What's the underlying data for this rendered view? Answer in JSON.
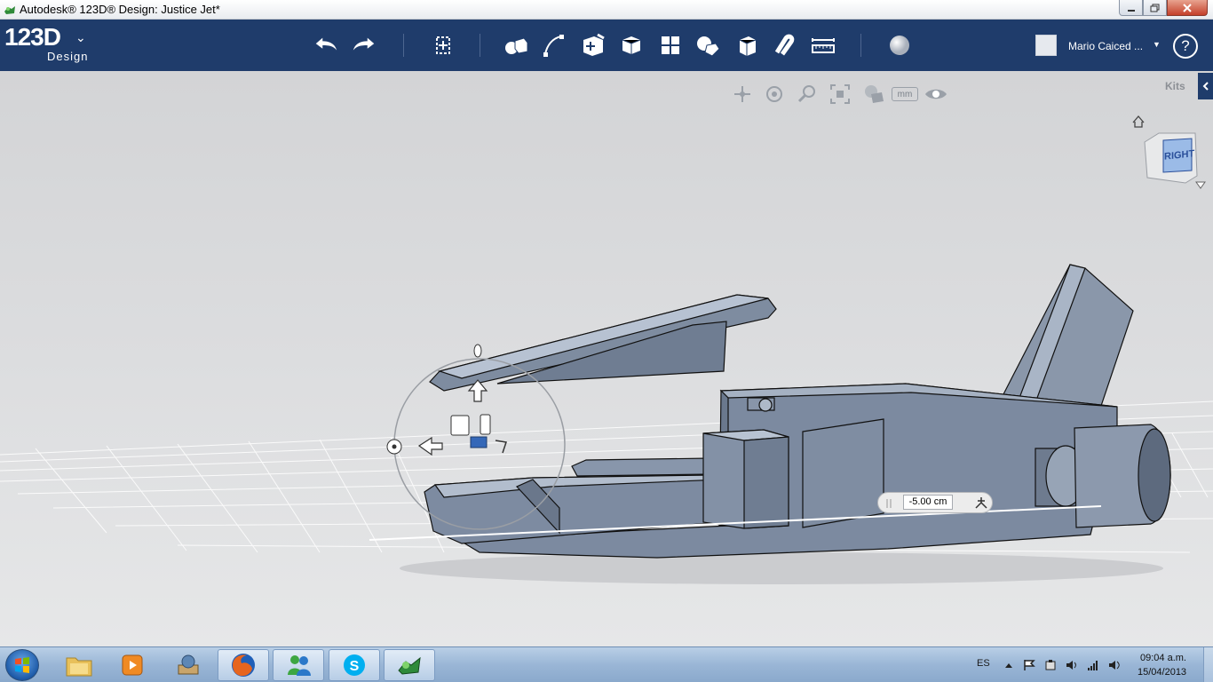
{
  "window": {
    "title": "Autodesk® 123D® Design: Justice Jet*",
    "minimize_icon": "minimize-icon",
    "maximize_icon": "restore-icon",
    "close_icon": "close-icon"
  },
  "toolbar": {
    "logo_main": "123D",
    "logo_sub": "Design",
    "tools": [
      "undo",
      "redo",
      "transform",
      "primitives",
      "sketch",
      "construct",
      "modify",
      "pattern",
      "grouping",
      "combine",
      "measure-snap",
      "snap",
      "ruler",
      "material"
    ],
    "user_name": "Mario Caiced ...",
    "help_label": "?"
  },
  "viewport": {
    "kits_label": "Kits",
    "nav_tools": [
      "pan",
      "orbit",
      "zoom",
      "fit",
      "view-mode",
      "units",
      "visibility"
    ],
    "units_label": "mm",
    "viewcube_face": "RIGHT",
    "dimension_value": "-5.00 cm"
  },
  "taskbar": {
    "apps": [
      "file-explorer",
      "media-player",
      "archive",
      "firefox",
      "messenger",
      "skype",
      "123d-design"
    ],
    "language": "ES",
    "time": "09:04 a.m.",
    "date": "15/04/2013"
  }
}
